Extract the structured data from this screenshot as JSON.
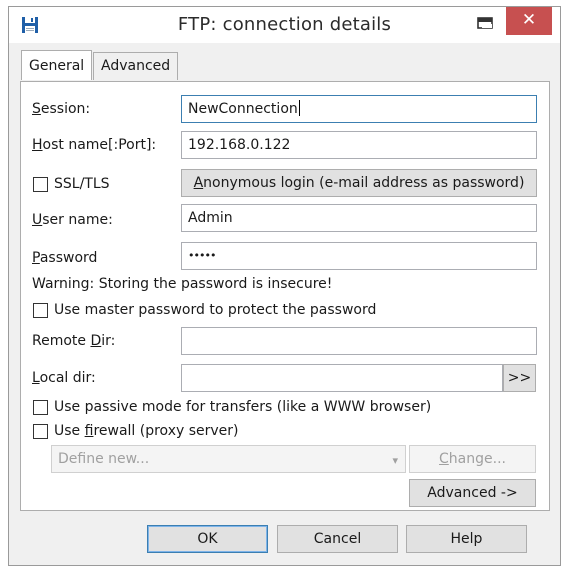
{
  "window": {
    "title": "FTP: connection details",
    "close_glyph": "✕"
  },
  "tabs": [
    {
      "label": "General",
      "active": true
    },
    {
      "label": "Advanced",
      "active": false
    }
  ],
  "general": {
    "session": {
      "label_key": "S",
      "label_rest": "ession:",
      "value": "NewConnection"
    },
    "host": {
      "label_key": "H",
      "label_rest": "ost name[:Port]:",
      "value": "192.168.0.122"
    },
    "ssl": {
      "label": "SSL/TLS",
      "checked": false
    },
    "anonymous_button": {
      "key": "A",
      "rest": "nonymous login (e-mail address as password)"
    },
    "username": {
      "label_key": "U",
      "label_rest": "ser name:",
      "value": "Admin"
    },
    "password": {
      "label_key": "P",
      "label_rest": "assword",
      "value": "•••••"
    },
    "warning": "Warning: Storing the password is insecure!",
    "master_password": {
      "label": "Use master password to protect the password",
      "checked": false
    },
    "remote_dir": {
      "label_pre": "Remote ",
      "label_key": "D",
      "label_rest": "ir:",
      "value": ""
    },
    "local_dir": {
      "label_key": "L",
      "label_rest": "ocal dir:",
      "value": "",
      "browse": ">>"
    },
    "passive_mode": {
      "label": "Use passive mode for transfers (like a WWW browser)",
      "checked": false
    },
    "firewall": {
      "label_pre": "Use ",
      "label_key": "f",
      "label_rest": "irewall (proxy server)",
      "checked": false
    },
    "proxy_combo": {
      "value": "Define new...",
      "arrow": "▾"
    },
    "change_button": {
      "key": "C",
      "rest": "hange..."
    },
    "advanced_button": "Advanced ->"
  },
  "footer": {
    "ok": "OK",
    "cancel": "Cancel",
    "help": "Help"
  },
  "colors": {
    "close": "#c75050",
    "focus": "#3c7fb1",
    "accent": "#1f5fa8"
  }
}
